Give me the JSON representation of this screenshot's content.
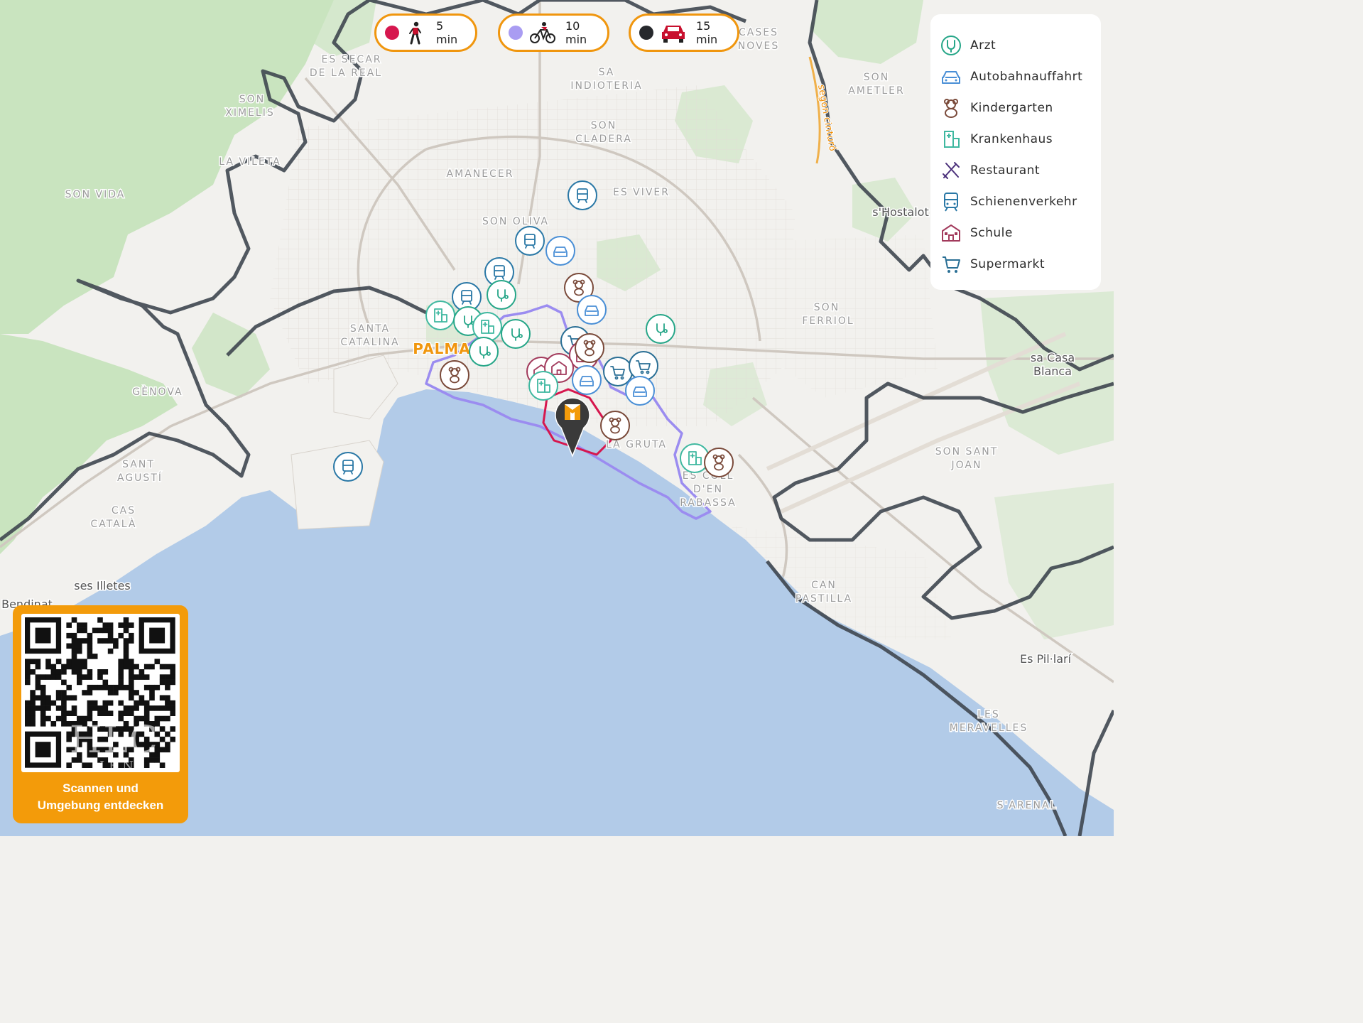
{
  "map": {
    "colors": {
      "land": "#f2f1ee",
      "green": "#c9e4bf",
      "sea": "#b2cbe8",
      "road_major": "#cfc8c0",
      "road_ring": "#f0b04a",
      "isochrone_walk": "#d6174e",
      "isochrone_bike": "#9b8cf0",
      "isochrone_car": "#3f4750"
    },
    "place_labels": [
      {
        "name": "ES SECAR",
        "type": "district"
      },
      {
        "name": "DE LA REAL",
        "type": "district"
      },
      {
        "name": "SON",
        "type": "district"
      },
      {
        "name": "XIMELIS",
        "type": "district"
      },
      {
        "name": "LA VILETA",
        "type": "district"
      },
      {
        "name": "SON VIDA",
        "type": "district"
      },
      {
        "name": "SA",
        "type": "district"
      },
      {
        "name": "INDIOTERIA",
        "type": "district"
      },
      {
        "name": "SON",
        "type": "district"
      },
      {
        "name": "CLADERA",
        "type": "district"
      },
      {
        "name": "AMANECER",
        "type": "district"
      },
      {
        "name": "ES VIVER",
        "type": "district"
      },
      {
        "name": "SON OLIVA",
        "type": "district"
      },
      {
        "name": "SANTA",
        "type": "district"
      },
      {
        "name": "CATALINA",
        "type": "district"
      },
      {
        "name": "PALMA",
        "type": "city"
      },
      {
        "name": "GÈNOVA",
        "type": "district"
      },
      {
        "name": "SANT",
        "type": "district"
      },
      {
        "name": "AGUSTÍ",
        "type": "district"
      },
      {
        "name": "CAS",
        "type": "district"
      },
      {
        "name": "CATALÀ",
        "type": "district"
      },
      {
        "name": "ses Illetes",
        "type": "town"
      },
      {
        "name": "Bendinat",
        "type": "town"
      },
      {
        "name": "CASES",
        "type": "district"
      },
      {
        "name": "NOVES",
        "type": "district"
      },
      {
        "name": "SON",
        "type": "district"
      },
      {
        "name": "AMETLER",
        "type": "district"
      },
      {
        "name": "SON",
        "type": "district"
      },
      {
        "name": "FERRIOL",
        "type": "district"
      },
      {
        "name": "s'Hostalot",
        "type": "town"
      },
      {
        "name": "sa Casa",
        "type": "town"
      },
      {
        "name": "Blanca",
        "type": "town"
      },
      {
        "name": "LA GRUTA",
        "type": "district"
      },
      {
        "name": "ES COLL",
        "type": "district"
      },
      {
        "name": "D'EN",
        "type": "district"
      },
      {
        "name": "RABASSA",
        "type": "district"
      },
      {
        "name": "SON SANT",
        "type": "district"
      },
      {
        "name": "JOAN",
        "type": "district"
      },
      {
        "name": "CAN",
        "type": "district"
      },
      {
        "name": "PASTILLA",
        "type": "district"
      },
      {
        "name": "Es Pil·larí",
        "type": "town"
      },
      {
        "name": "LES",
        "type": "district"
      },
      {
        "name": "MERAVELLES",
        "type": "district"
      },
      {
        "name": "S'ARENAL",
        "type": "district"
      }
    ],
    "road_labels": [
      "segon cinturó"
    ],
    "markers": [
      {
        "category": "schienenverkehr"
      },
      {
        "category": "schienenverkehr"
      },
      {
        "category": "autobahnauffahrt"
      },
      {
        "category": "schienenverkehr"
      },
      {
        "category": "kindergarten"
      },
      {
        "category": "schienenverkehr"
      },
      {
        "category": "arzt"
      },
      {
        "category": "autobahnauffahrt"
      },
      {
        "category": "krankenhaus"
      },
      {
        "category": "arzt"
      },
      {
        "category": "krankenhaus"
      },
      {
        "category": "arzt"
      },
      {
        "category": "arzt"
      },
      {
        "category": "arzt"
      },
      {
        "category": "supermarkt"
      },
      {
        "category": "schule"
      },
      {
        "category": "kindergarten"
      },
      {
        "category": "schule"
      },
      {
        "category": "schule"
      },
      {
        "category": "krankenhaus"
      },
      {
        "category": "supermarkt"
      },
      {
        "category": "supermarkt"
      },
      {
        "category": "autobahnauffahrt"
      },
      {
        "category": "autobahnauffahrt"
      },
      {
        "category": "kindergarten"
      },
      {
        "category": "kindergarten"
      },
      {
        "category": "krankenhaus"
      },
      {
        "category": "kindergarten"
      },
      {
        "category": "schienenverkehr"
      }
    ],
    "location_pin": {
      "name": "property-location"
    }
  },
  "travel_modes": [
    {
      "mode": "walk",
      "icon": "walking-person-icon",
      "color": "#d6174e",
      "label": "5 min"
    },
    {
      "mode": "bike",
      "icon": "bicycle-icon",
      "color": "#a99cf2",
      "label": "10 min"
    },
    {
      "mode": "car",
      "icon": "car-icon",
      "color": "#26282c",
      "label": "15 min"
    }
  ],
  "legend": {
    "items": [
      {
        "label": "Arzt",
        "icon": "stethoscope-icon",
        "color": "#26a688"
      },
      {
        "label": "Autobahnauffahrt",
        "icon": "car-icon",
        "color": "#4a8fd6"
      },
      {
        "label": "Kindergarten",
        "icon": "teddy-bear-icon",
        "color": "#7a4a3a"
      },
      {
        "label": "Krankenhaus",
        "icon": "hospital-icon",
        "color": "#3fb8a0"
      },
      {
        "label": "Restaurant",
        "icon": "cutlery-icon",
        "color": "#4a2f7a"
      },
      {
        "label": "Schienenverkehr",
        "icon": "train-icon",
        "color": "#2a78a6"
      },
      {
        "label": "Schule",
        "icon": "school-icon",
        "color": "#a23a5c"
      },
      {
        "label": "Supermarkt",
        "icon": "shopping-cart-icon",
        "color": "#2a6f95"
      }
    ]
  },
  "qr_card": {
    "line1": "Scannen und",
    "line2": "Umgebung entdecken",
    "color": "#f39b0a"
  },
  "watermark": {
    "main": "HLC",
    "sub": "IEN"
  }
}
